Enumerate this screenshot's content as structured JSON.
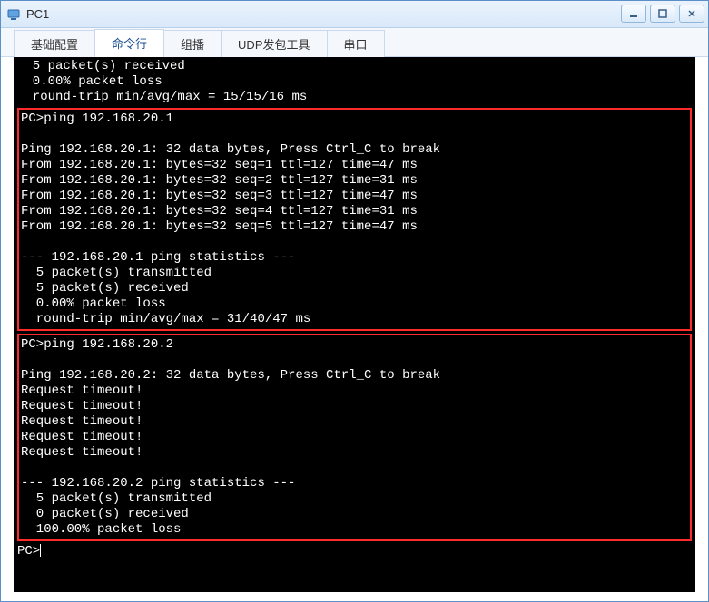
{
  "window": {
    "title": "PC1"
  },
  "tabs": {
    "t0": "基础配置",
    "t1": "命令行",
    "t2": "组播",
    "t3": "UDP发包工具",
    "t4": "串口"
  },
  "terminal": {
    "pre_lines": {
      "l1": "  5 packet(s) received",
      "l2": "  0.00% packet loss",
      "l3": "  round-trip min/avg/max = 15/15/16 ms"
    },
    "block1": {
      "cmd": "PC>ping 192.168.20.1",
      "hdr": "Ping 192.168.20.1: 32 data bytes, Press Ctrl_C to break",
      "r1": "From 192.168.20.1: bytes=32 seq=1 ttl=127 time=47 ms",
      "r2": "From 192.168.20.1: bytes=32 seq=2 ttl=127 time=31 ms",
      "r3": "From 192.168.20.1: bytes=32 seq=3 ttl=127 time=47 ms",
      "r4": "From 192.168.20.1: bytes=32 seq=4 ttl=127 time=31 ms",
      "r5": "From 192.168.20.1: bytes=32 seq=5 ttl=127 time=47 ms",
      "stats_hdr": "--- 192.168.20.1 ping statistics ---",
      "s1": "  5 packet(s) transmitted",
      "s2": "  5 packet(s) received",
      "s3": "  0.00% packet loss",
      "s4": "  round-trip min/avg/max = 31/40/47 ms"
    },
    "block2": {
      "cmd": "PC>ping 192.168.20.2",
      "hdr": "Ping 192.168.20.2: 32 data bytes, Press Ctrl_C to break",
      "r1": "Request timeout!",
      "r2": "Request timeout!",
      "r3": "Request timeout!",
      "r4": "Request timeout!",
      "r5": "Request timeout!",
      "stats_hdr": "--- 192.168.20.2 ping statistics ---",
      "s1": "  5 packet(s) transmitted",
      "s2": "  0 packet(s) received",
      "s3": "  100.00% packet loss"
    },
    "prompt": "PC>"
  }
}
